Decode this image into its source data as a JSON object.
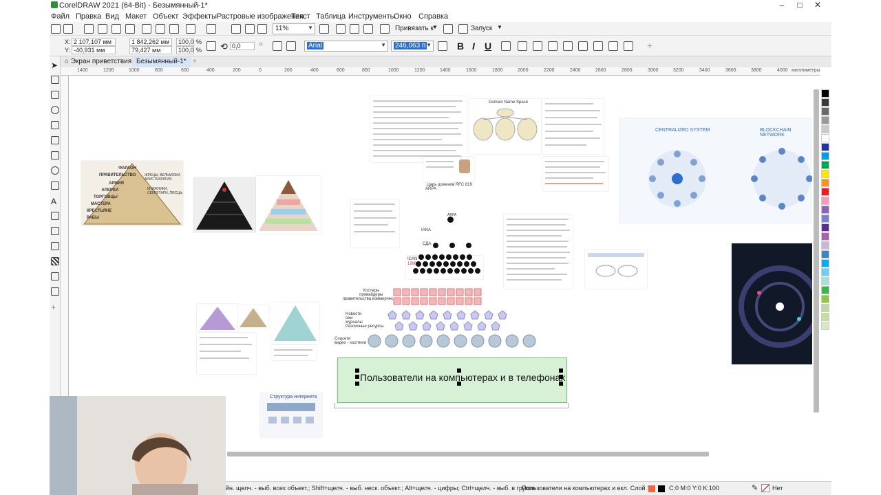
{
  "window": {
    "title": "CorelDRAW 2021 (64-Bit) - Безымянный-1*",
    "minimize": "–",
    "maximize": "□",
    "close": "✕"
  },
  "menu": [
    "Файл",
    "Правка",
    "Вид",
    "Макет",
    "Объект",
    "Эффекты",
    "Растровые изображения",
    "Текст",
    "Таблица",
    "Инструменты",
    "Окно",
    "Справка"
  ],
  "toolbar": {
    "zoom": "11%",
    "snap_label": "Привязать к",
    "launch_label": "Запуск"
  },
  "properties": {
    "x": "2 107,107 мм",
    "y": "-40,931 мм",
    "width": "1 842,262 мм",
    "height": "79,427 мм",
    "scale_x": "100,0",
    "scale_y": "100,0",
    "pct": "%",
    "rotation": "0,0",
    "font": "Arial",
    "font_size": "246,063 п",
    "bold": "B",
    "italic": "I",
    "underline": "U",
    "x_label": "X:",
    "y_label": "Y:"
  },
  "tabs": {
    "welcome": "Экран приветствия",
    "document": "Безымянный-1*",
    "add": "+"
  },
  "ruler": {
    "ticks": [
      "1400",
      "1200",
      "1000",
      "800",
      "600",
      "400",
      "200",
      "0",
      "200",
      "400",
      "600",
      "800",
      "1000",
      "1200",
      "1400",
      "1600",
      "1800",
      "2000",
      "2200",
      "2400",
      "2600",
      "2800",
      "3000",
      "3200",
      "3400",
      "3600",
      "3800",
      "4000",
      "4200"
    ],
    "unit": "миллиметры"
  },
  "canvas": {
    "pyramid1_labels": [
      "ФАРАОН",
      "ПРАВИТЕЛЬСТВО",
      "ЖРЕЦЫ, ВЕЛЬМОЖИ, АРИСТОКРАТИЯ",
      "АРМИЯ",
      "КЛЕРКИ",
      "КНИЖНИКИ, СЕКРЕТАРИ, ПИСЦЫ",
      "ТОРГОВЦЫ",
      "МАСТЕРА",
      "КРЕСТЬЯНЕ",
      "РАБЫ"
    ],
    "dns_title": "Domain Name Space",
    "rfc_caption": "Царь доменов RFC 819",
    "arpa": "ARPA",
    "iana": "IANA",
    "sda": "СДА",
    "icann": "ICAN",
    "year": "1998",
    "layer_hosts": "Хостеры\nпровайдеры\nправительства коммерческие",
    "layer_news": "Новости\nсми\nжурналы\nРазличные ресурсы",
    "layer_social": "Соцсети\nвидео - хостинги",
    "users_text": "Пользователи на компьютерах и в телефонах",
    "centralized": "CENTRALIZED SYSTEM",
    "blockchain": "BLOCKCHAIN NETWORK",
    "internet_structure": "Структура интернета"
  },
  "status": {
    "hint": "йн. щелч. - выб. всех объект.; Shift+щелч. - выб. неск. объект.; Alt+щелч. - цифры; Ctrl+щелч. - выб. в группе",
    "object": "Пользователи на компьютерах и  вкл. Слой 1",
    "color": "C:0 M:0 Y:0 K:100",
    "fill": "Нет"
  },
  "colors": {
    "accent_blue": "#2c6fd1",
    "text_green_fill": "#d6f1d6",
    "pyramid_black": "#1a1a1a"
  }
}
